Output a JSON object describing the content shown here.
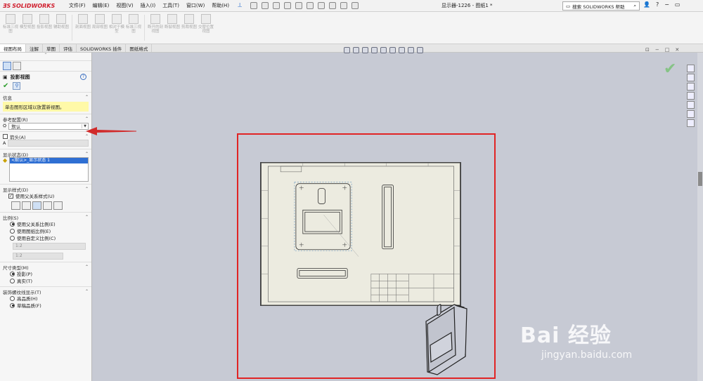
{
  "app": {
    "logo": "SOLIDWORKS",
    "menu": [
      "文件(F)",
      "编辑(E)",
      "视图(V)",
      "插入(I)",
      "工具(T)",
      "窗口(W)",
      "帮助(H)"
    ],
    "doc_title": "显示器-1226 - 图纸1 *",
    "search_placeholder": "搜索 SOLIDWORKS 帮助"
  },
  "ribbon": {
    "buttons": [
      "标准三视图",
      "模型视图",
      "投影视图",
      "辅助视图",
      "剖面视图",
      "局部视图",
      "相对于模型",
      "标准三视图",
      "断开的剖视图",
      "断裂视图",
      "剪裁视图",
      "交替位置视图"
    ]
  },
  "tabs": [
    "视图布局",
    "注解",
    "草图",
    "评估",
    "SOLIDWORKS 插件",
    "图纸格式"
  ],
  "panel": {
    "title": "投影视图",
    "info": {
      "header": "信息",
      "text": "单击图形区域以放置新视图。"
    },
    "reference": {
      "header": "参考配置(R)",
      "value": "默认"
    },
    "arrow": {
      "header": "箭头(A)",
      "checked": false,
      "field": "A"
    },
    "display_state": {
      "header": "显示状态(D)",
      "item": "<默认>_显示状态 1"
    },
    "display_style": {
      "header": "显示样式(D)",
      "use_parent": "使用父关系样式(U)"
    },
    "scale": {
      "header": "比例(S)",
      "options": [
        "使用父关系比例(E)",
        "使用图纸比例(E)",
        "使用自定义比例(C)"
      ],
      "selected": 0,
      "combo_value": "1:2",
      "field_value": "1:2"
    },
    "dim_type": {
      "header": "尺寸类型(M)",
      "options": [
        "投影(P)",
        "真实(T)"
      ],
      "selected": 0
    },
    "cosmetic_thread": {
      "header": "装饰螺纹线显示(T)",
      "options": [
        "高品质(H)",
        "草稿品质(F)"
      ],
      "selected": 1
    }
  },
  "watermark": {
    "brand": "Bai 经验",
    "url": "jingyan.baidu.com"
  },
  "colors": {
    "highlight_red": "#e12424",
    "info_yellow": "#fff9a8",
    "selection_blue": "#2f6fd3"
  }
}
